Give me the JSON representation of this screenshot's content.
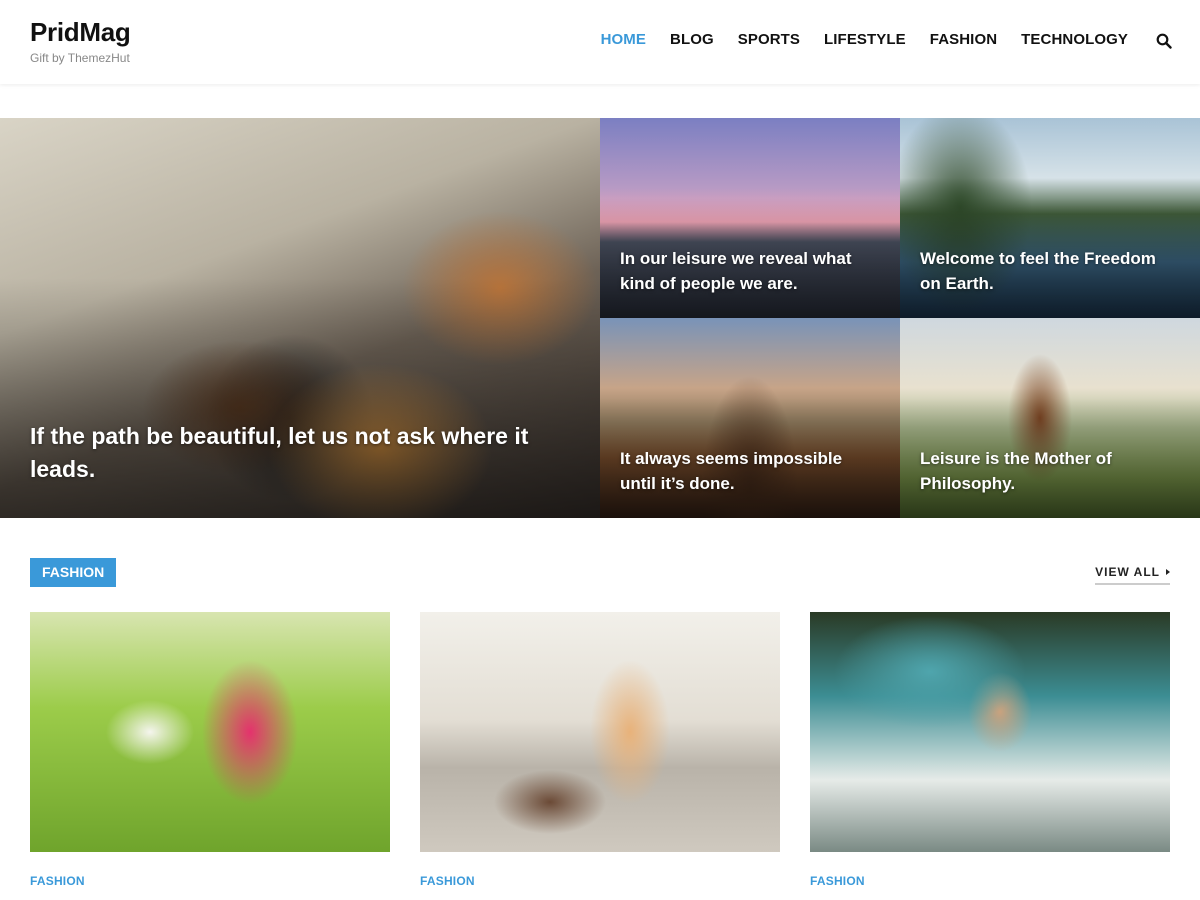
{
  "header": {
    "site_title": "PridMag",
    "tagline": "Gift by ThemezHut",
    "nav": [
      {
        "label": "HOME",
        "active": true
      },
      {
        "label": "BLOG",
        "active": false
      },
      {
        "label": "SPORTS",
        "active": false
      },
      {
        "label": "LIFESTYLE",
        "active": false
      },
      {
        "label": "FASHION",
        "active": false
      },
      {
        "label": "TECHNOLOGY",
        "active": false
      }
    ],
    "search_icon": "search-icon"
  },
  "hero": {
    "posts": [
      {
        "title": "If the path be beautiful, let us not ask where it leads."
      },
      {
        "title": "In our leisure we reveal what kind of people we are."
      },
      {
        "title": "Welcome to feel the Freedom on Earth."
      },
      {
        "title": "It always seems impossible until it’s done."
      },
      {
        "title": "Leisure is the Mother of Philosophy."
      }
    ]
  },
  "section": {
    "tag": "FASHION",
    "view_all": "VIEW ALL",
    "cards": [
      {
        "category": "FASHION"
      },
      {
        "category": "FASHION"
      },
      {
        "category": "FASHION"
      }
    ]
  },
  "colors": {
    "accent": "#3a99d9",
    "text": "#111111",
    "muted": "#888888"
  }
}
